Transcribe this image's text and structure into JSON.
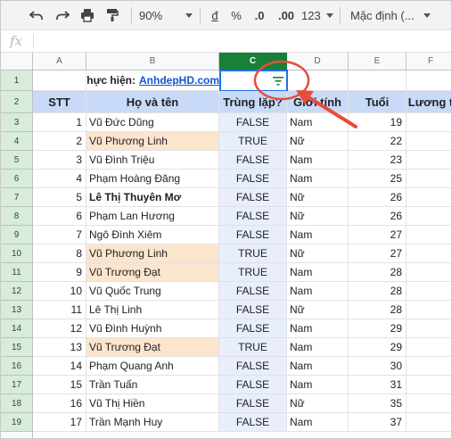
{
  "toolbar": {
    "zoom": "90%",
    "currency": "đ",
    "percent": "%",
    "dec_decrease": ".0",
    "dec_increase": ".00",
    "more_formats": "123",
    "font": "Mặc định (..."
  },
  "formula_bar": {
    "fx_label": "fx"
  },
  "columns": [
    "A",
    "B",
    "C",
    "D",
    "E",
    "F"
  ],
  "row1": {
    "label": "Thực hiện:",
    "link": "AnhdepHD.com"
  },
  "headers": [
    "STT",
    "Họ và tên",
    "Trùng lặp?",
    "Giới tính",
    "Tuổi",
    "Lương t"
  ],
  "rows": [
    {
      "n": "3",
      "stt": "1",
      "name": "Vũ Đức Dũng",
      "dup": "FALSE",
      "sex": "Nam",
      "age": "19",
      "hl": false,
      "bold": false
    },
    {
      "n": "4",
      "stt": "2",
      "name": "Vũ Phương Linh",
      "dup": "TRUE",
      "sex": "Nữ",
      "age": "22",
      "hl": true,
      "bold": false
    },
    {
      "n": "5",
      "stt": "3",
      "name": "Vũ Đình Triệu",
      "dup": "FALSE",
      "sex": "Nam",
      "age": "23",
      "hl": false,
      "bold": false
    },
    {
      "n": "6",
      "stt": "4",
      "name": "Phạm Hoàng Đăng",
      "dup": "FALSE",
      "sex": "Nam",
      "age": "25",
      "hl": false,
      "bold": false
    },
    {
      "n": "7",
      "stt": "5",
      "name": "Lê Thị Thuyên Mơ",
      "dup": "FALSE",
      "sex": "Nữ",
      "age": "26",
      "hl": false,
      "bold": true
    },
    {
      "n": "8",
      "stt": "6",
      "name": "Phạm Lan Hương",
      "dup": "FALSE",
      "sex": "Nữ",
      "age": "26",
      "hl": false,
      "bold": false
    },
    {
      "n": "9",
      "stt": "7",
      "name": "Ngô Đình Xiêm",
      "dup": "FALSE",
      "sex": "Nam",
      "age": "27",
      "hl": false,
      "bold": false
    },
    {
      "n": "10",
      "stt": "8",
      "name": "Vũ Phương Linh",
      "dup": "TRUE",
      "sex": "Nữ",
      "age": "27",
      "hl": true,
      "bold": false
    },
    {
      "n": "11",
      "stt": "9",
      "name": "Vũ Trương Đạt",
      "dup": "TRUE",
      "sex": "Nam",
      "age": "28",
      "hl": true,
      "bold": false
    },
    {
      "n": "12",
      "stt": "10",
      "name": "Vũ Quốc Trung",
      "dup": "FALSE",
      "sex": "Nam",
      "age": "28",
      "hl": false,
      "bold": false
    },
    {
      "n": "13",
      "stt": "11",
      "name": "Lê Thị Linh",
      "dup": "FALSE",
      "sex": "Nữ",
      "age": "28",
      "hl": false,
      "bold": false
    },
    {
      "n": "14",
      "stt": "12",
      "name": "Vũ Đình Huỳnh",
      "dup": "FALSE",
      "sex": "Nam",
      "age": "29",
      "hl": false,
      "bold": false
    },
    {
      "n": "15",
      "stt": "13",
      "name": "Vũ Trương Đạt",
      "dup": "TRUE",
      "sex": "Nam",
      "age": "29",
      "hl": true,
      "bold": false
    },
    {
      "n": "16",
      "stt": "14",
      "name": "Phạm Quang Anh",
      "dup": "FALSE",
      "sex": "Nam",
      "age": "30",
      "hl": false,
      "bold": false
    },
    {
      "n": "17",
      "stt": "15",
      "name": "Trần Tuấn",
      "dup": "FALSE",
      "sex": "Nam",
      "age": "31",
      "hl": false,
      "bold": false
    },
    {
      "n": "18",
      "stt": "16",
      "name": "Vũ Thị Hiền",
      "dup": "FALSE",
      "sex": "Nữ",
      "age": "35",
      "hl": false,
      "bold": false
    },
    {
      "n": "19",
      "stt": "17",
      "name": "Trần Mạnh Huy",
      "dup": "FALSE",
      "sex": "Nam",
      "age": "37",
      "hl": false,
      "bold": false
    }
  ],
  "colors": {
    "header_bg": "#c9daf8",
    "duplicate_bg": "#fce5cd",
    "selected_col": "#188038",
    "annotation": "#e74c3c"
  }
}
